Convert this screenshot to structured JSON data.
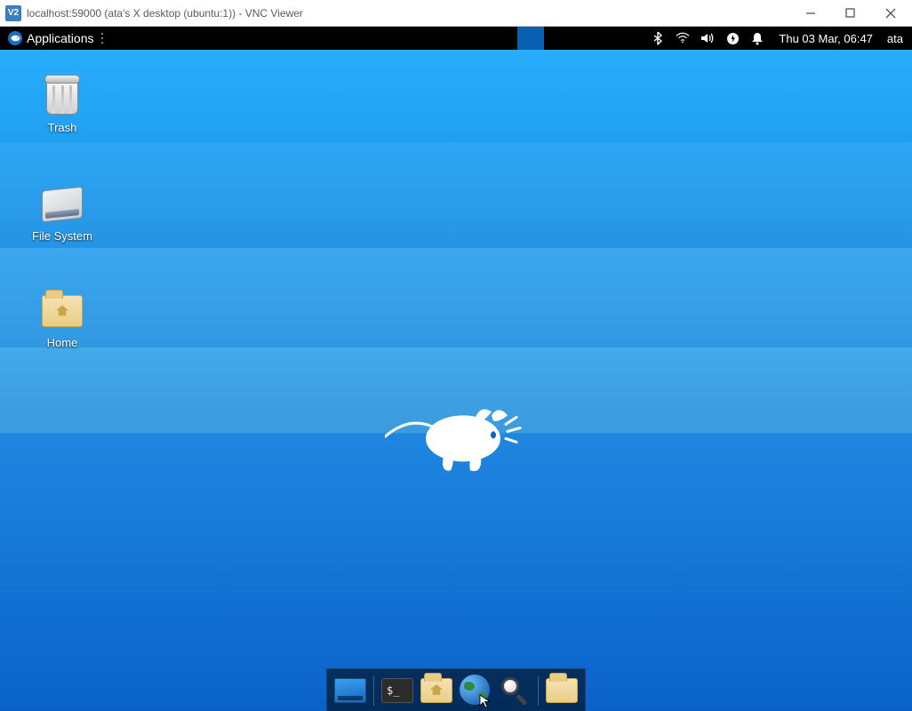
{
  "window": {
    "title": "localhost:59000 (ata's X desktop (ubuntu:1)) - VNC Viewer"
  },
  "panel": {
    "applications_label": "Applications",
    "clock": "Thu 03 Mar, 06:47",
    "user": "ata"
  },
  "desktop_icons": {
    "trash": "Trash",
    "filesystem": "File System",
    "home": "Home"
  },
  "dock": {
    "terminal_prompt": "$_"
  }
}
